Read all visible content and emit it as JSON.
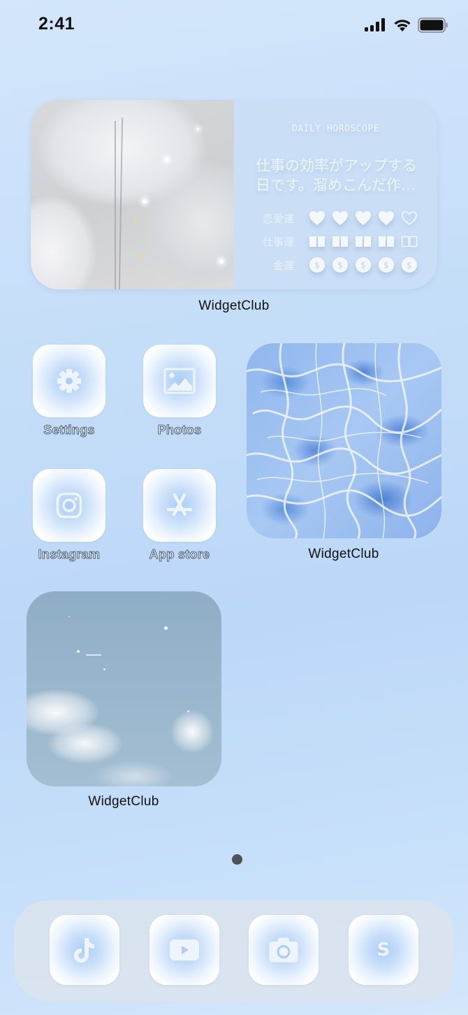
{
  "status_bar": {
    "time": "2:41",
    "icons": [
      "cellular-signal-icon",
      "wifi-icon",
      "battery-icon"
    ]
  },
  "horoscope_widget": {
    "title": "DAILY HOROSCOPE",
    "message": "仕事の効率がアップする日です。溜めこんだ作…",
    "message_lines": [
      "仕事の効率がアップする",
      "日です。溜めこんだ作…"
    ],
    "rows": [
      {
        "label": "恋愛運",
        "icon": "heart-icon",
        "filled": 4,
        "total": 5
      },
      {
        "label": "仕事運",
        "icon": "book-icon",
        "filled": 4,
        "total": 5
      },
      {
        "label": "金運",
        "icon": "coin-icon",
        "filled": 5,
        "total": 5
      }
    ],
    "app_label": "WidgetClub"
  },
  "apps": [
    {
      "name": "Settings",
      "icon": "gear-icon"
    },
    {
      "name": "Photos",
      "icon": "photo-icon"
    },
    {
      "name": "Instagram",
      "icon": "instagram-icon"
    },
    {
      "name": "App store",
      "icon": "app-store-icon"
    }
  ],
  "water_widget": {
    "app_label": "WidgetClub"
  },
  "sky_widget": {
    "app_label": "WidgetClub"
  },
  "page_indicator": {
    "current": 1,
    "total": 1
  },
  "dock": [
    {
      "name": "TikTok",
      "icon": "tiktok-icon"
    },
    {
      "name": "YouTube",
      "icon": "youtube-icon"
    },
    {
      "name": "Camera",
      "icon": "camera-icon"
    },
    {
      "name": "Shazam",
      "icon": "s-letter-icon",
      "glyph": "S"
    }
  ],
  "colors": {
    "background": "#c4ddf8",
    "icon_glow": "#a9cdf7",
    "icon_glyph": "#eef4fd",
    "label_text": "#111111",
    "page_dot": "#4e5257"
  }
}
